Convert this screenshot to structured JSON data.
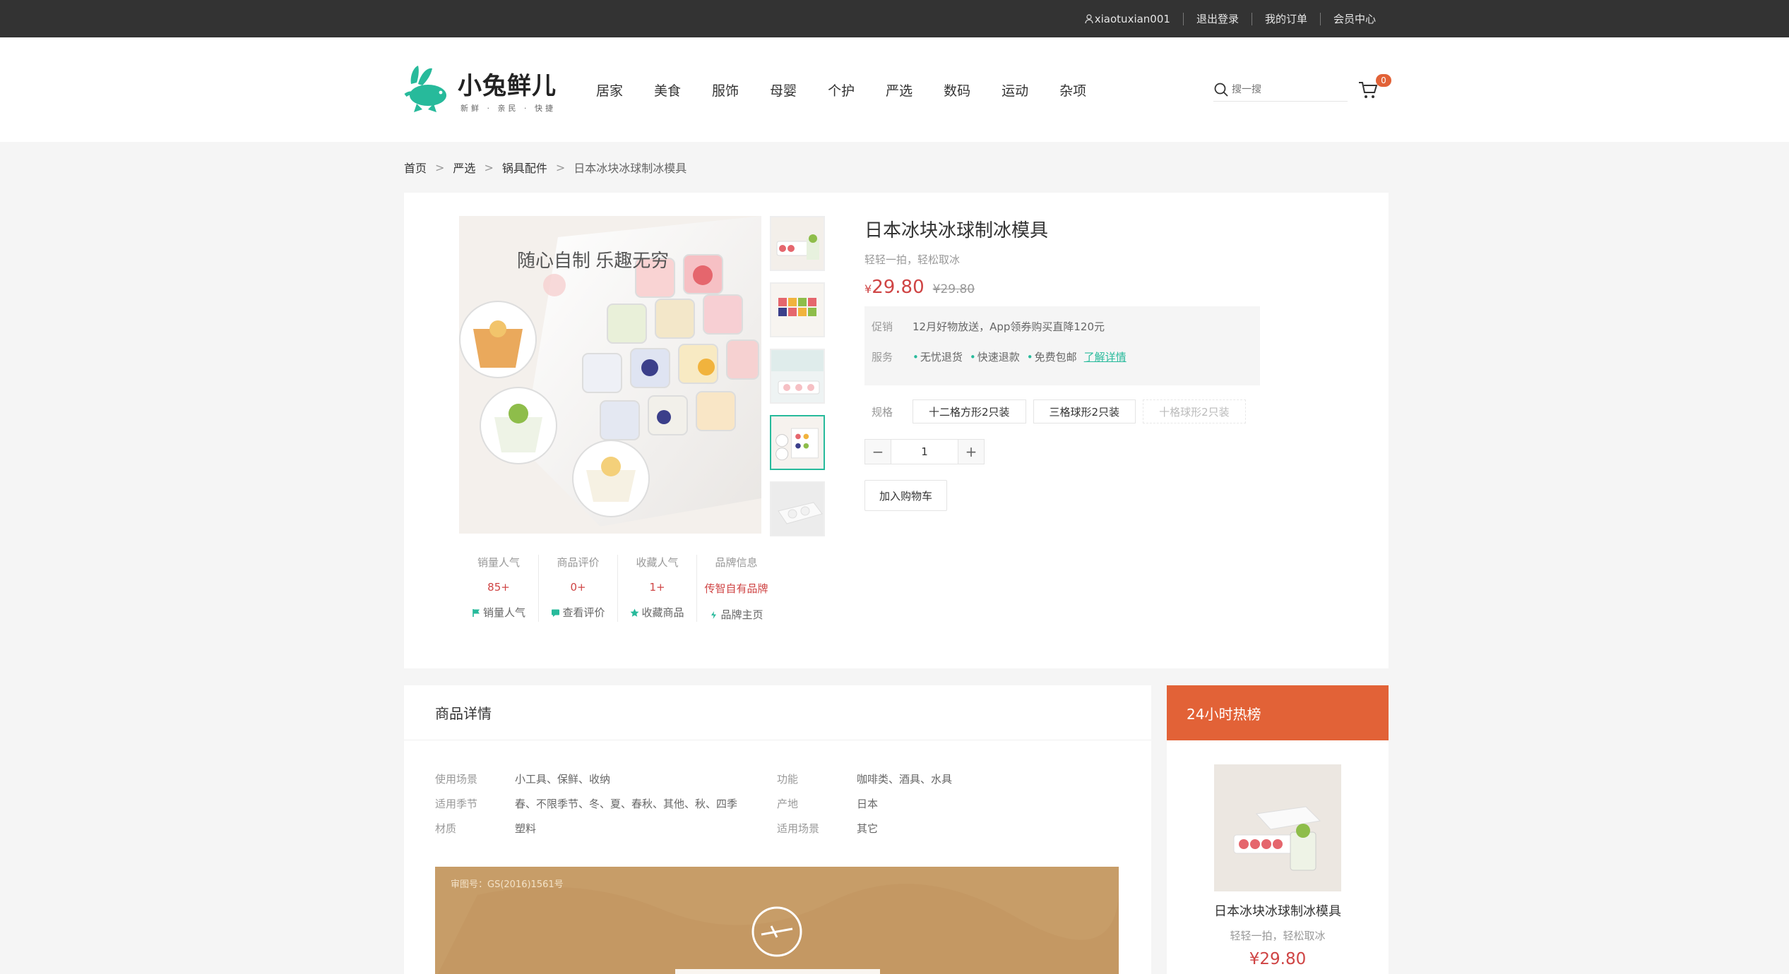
{
  "topbar": {
    "username": "xiaotuxian001",
    "logout": "退出登录",
    "orders": "我的订单",
    "member": "会员中心"
  },
  "header": {
    "logo_title": "小兔鲜儿",
    "logo_sub": "新鲜 · 亲民 · 快捷",
    "nav": [
      "居家",
      "美食",
      "服饰",
      "母婴",
      "个护",
      "严选",
      "数码",
      "运动",
      "杂项"
    ],
    "search_placeholder": "搜一搜",
    "cart_count": "0"
  },
  "breadcrumb": [
    "首页",
    "严选",
    "锅具配件",
    "日本冰块冰球制冰模具"
  ],
  "product": {
    "main_image_caption": "随心自制 乐趣无穷",
    "stats": [
      {
        "label": "销量人气",
        "value": "85+",
        "action": "销量人气"
      },
      {
        "label": "商品评价",
        "value": "0+",
        "action": "查看评价"
      },
      {
        "label": "收藏人气",
        "value": "1+",
        "action": "收藏商品"
      },
      {
        "label": "品牌信息",
        "value": "传智自有品牌",
        "action": "品牌主页"
      }
    ],
    "name": "日本冰块冰球制冰模具",
    "desc": "轻轻一拍，轻松取冰",
    "price_symbol": "¥",
    "price": "29.80",
    "old_price": "¥29.80",
    "promo_label": "促销",
    "promo_text": "12月好物放送，App领券购买直降120元",
    "service_label": "服务",
    "services": [
      "无忧退货",
      "快速退款",
      "免费包邮"
    ],
    "service_more": "了解详情",
    "spec_label": "规格",
    "specs": [
      "十二格方形2只装",
      "三格球形2只装",
      "十格球形2只装"
    ],
    "quantity": "1",
    "add_cart": "加入购物车"
  },
  "detail": {
    "title": "商品详情",
    "attrs": [
      {
        "k": "使用场景",
        "v": "小工具、保鲜、收纳"
      },
      {
        "k": "功能",
        "v": "咖啡类、酒具、水具"
      },
      {
        "k": "适用季节",
        "v": "春、不限季节、冬、夏、春秋、其他、秋、四季"
      },
      {
        "k": "产地",
        "v": "日本"
      },
      {
        "k": "材质",
        "v": "塑料"
      },
      {
        "k": "适用场景",
        "v": "其它"
      }
    ],
    "banner_license": "审图号：GS(2016)1561号"
  },
  "hot": {
    "title": "24小时热榜",
    "item_name": "日本冰块冰球制冰模具",
    "item_desc": "轻轻一拍，轻松取冰",
    "item_price": "¥29.80"
  },
  "colors": {
    "brand": "#27ba9b",
    "price": "#cf4444",
    "hot": "#e26237",
    "topbar": "#333333"
  }
}
